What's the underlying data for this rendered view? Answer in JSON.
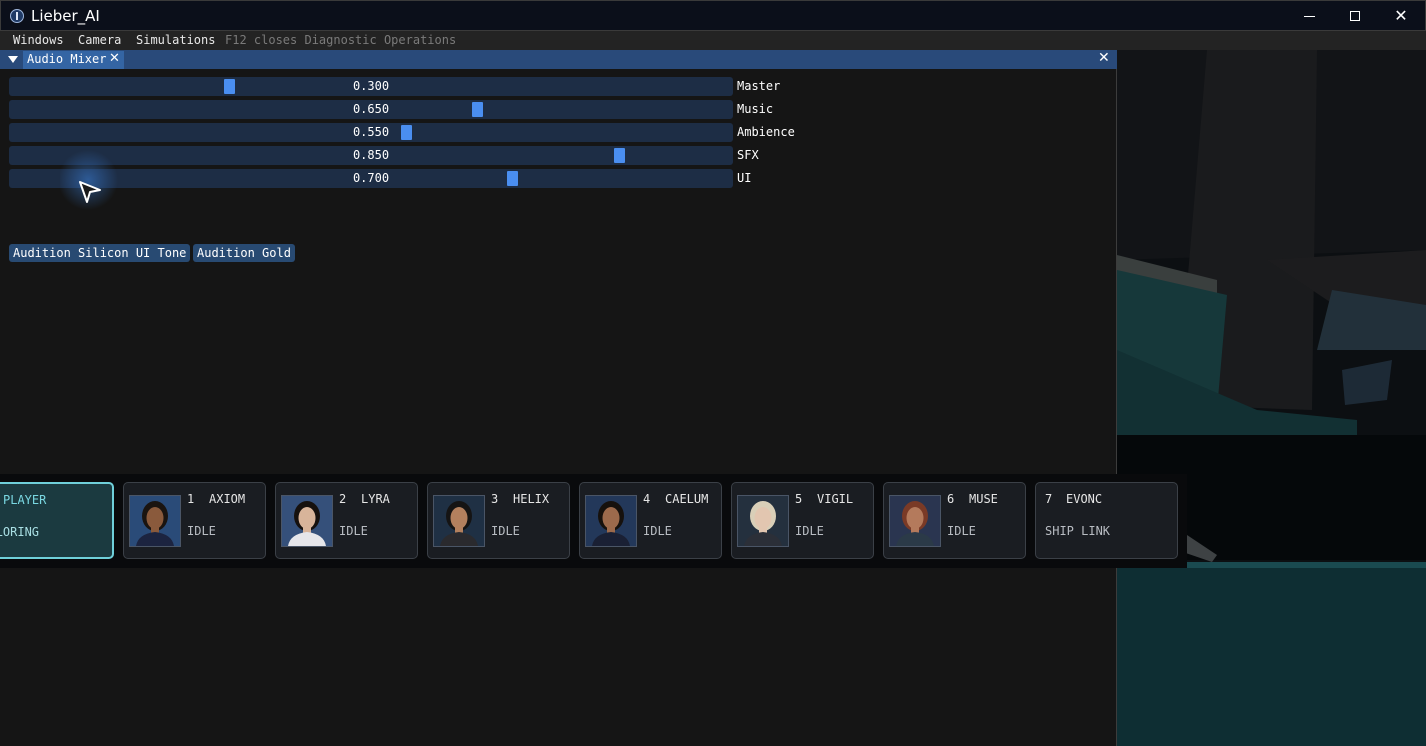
{
  "window": {
    "title": "Lieber_AI"
  },
  "menubar": {
    "items": [
      "Windows",
      "Camera",
      "Simulations"
    ],
    "hint": "F12 closes Diagnostic Operations"
  },
  "mixer": {
    "tab_label": "Audio Mixer",
    "sliders": [
      {
        "label": "Master",
        "value": 0.3,
        "display": "0.300"
      },
      {
        "label": "Music",
        "value": 0.65,
        "display": "0.650"
      },
      {
        "label": "Ambience",
        "value": 0.55,
        "display": "0.550"
      },
      {
        "label": "SFX",
        "value": 0.85,
        "display": "0.850"
      },
      {
        "label": "UI",
        "value": 0.7,
        "display": "0.700"
      }
    ],
    "buttons": [
      "Audition Silicon UI Tone",
      "Audition Gold"
    ]
  },
  "characters": [
    {
      "name": "PLAYER",
      "status": "EXPLORING",
      "active": true
    },
    {
      "num": "1",
      "name": "AXIOM",
      "status": "IDLE",
      "portrait_bg": "#2a4b78",
      "hair": "#1a1410",
      "skin": "#8a5a3c",
      "uniform": "#1c2440"
    },
    {
      "num": "2",
      "name": "LYRA",
      "status": "IDLE",
      "portrait_bg": "#35507a",
      "hair": "#16110e",
      "skin": "#d8b49a",
      "uniform": "#e6e6ea"
    },
    {
      "num": "3",
      "name": "HELIX",
      "status": "IDLE",
      "portrait_bg": "#1f3044",
      "hair": "#151414",
      "skin": "#b3805e",
      "uniform": "#2a2a2e"
    },
    {
      "num": "4",
      "name": "CAELUM",
      "status": "IDLE",
      "portrait_bg": "#23385a",
      "hair": "#16110d",
      "skin": "#9c6a4c",
      "uniform": "#1a2034"
    },
    {
      "num": "5",
      "name": "VIGIL",
      "status": "IDLE",
      "portrait_bg": "#24303e",
      "hair": "#d9cfb8",
      "skin": "#e2c6b0",
      "uniform": "#2b2f38"
    },
    {
      "num": "6",
      "name": "MUSE",
      "status": "IDLE",
      "portrait_bg": "#2a3550",
      "hair": "#7a3a26",
      "skin": "#b47a5c",
      "uniform": "#2b3a48"
    },
    {
      "num": "7",
      "name": "EVONC",
      "status": "SHIP LINK"
    }
  ],
  "colors": {
    "accent": "#4a8ef0",
    "header": "#294a7a",
    "active_card_border": "#6fd0da"
  }
}
